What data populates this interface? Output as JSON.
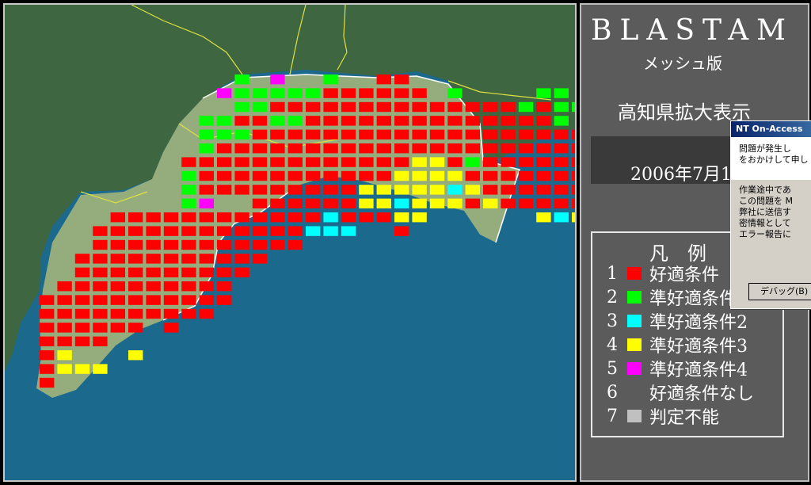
{
  "app": {
    "title": "BLASTAM",
    "subtitle": "メッシュ版",
    "region_label": "高知県拡大表示",
    "date_label": "2006年7月1"
  },
  "legend": {
    "title": "凡　例",
    "items": [
      {
        "num": "1",
        "label": "好適条件",
        "color": "#ff0000"
      },
      {
        "num": "2",
        "label": "準好適条件1",
        "color": "#00ff00"
      },
      {
        "num": "3",
        "label": "準好適条件2",
        "color": "#00ffff"
      },
      {
        "num": "4",
        "label": "準好適条件3",
        "color": "#ffff00"
      },
      {
        "num": "5",
        "label": "準好適条件4",
        "color": "#ff00ff"
      },
      {
        "num": "6",
        "label": "好適条件なし",
        "color": ""
      },
      {
        "num": "7",
        "label": "判定不能",
        "color": "#c0c0c0"
      }
    ]
  },
  "dialog": {
    "title": "NT On-Access",
    "top_lines": [
      "問題が発生し",
      "をおかけして申し"
    ],
    "body_lines": [
      "作業途中であ",
      "",
      "この問題を M",
      "弊社に送信す",
      "密情報として",
      "",
      "エラー報告に"
    ],
    "debug_button": "デバッグ(B)"
  },
  "colors": {
    "sea": "#1b6a8e",
    "land_kochi": "#95ad7d",
    "land_other": "#3d6641",
    "border": "#e0e040",
    "panel": "#5b5b5b"
  },
  "mesh_grid": {
    "comment_codes": "r=1 g=2 c=3 y=4 m=5 blank=none",
    "rows": [
      "...........g.m..g..rr..........",
      "..........mgggggrrrrrr.g....gg..",
      "...........ggrrrrrrrrrrrrrrgrgg..",
      ".........ggrrggrrrrrrrrrrrrrrg..g",
      ".........gggrrrrrrrrrrrrrrrrrrrrg",
      ".........grrrrrrrrrrrrrrrrrrrrr..",
      "........rrrrrrrrrrrrryyrgrrrrrr..",
      "........grrrrrrrrrrryyyyrrrrrrrr.",
      "........grrrrrrrrryyyyycyrrrrrrr.",
      "........gm..rrrrrryycyyyryrrrrr.r",
      "....rrrrrrrrrrrrcrrryy......ycy..",
      "...rrrrrrrrrrrrccc..r............",
      "...rrrrrrrrrrrr..................",
      "..rrrrrrrrrrr....................",
      "..rrrrrrrrrr.....................",
      ".rrrrrrrrrr......................",
      "rrrrrrrrrrr......................",
      "rrrrrrrrrr.......................",
      "rrrrrr.r.........................",
      "rrrr.............................",
      "ry...y...........................",
      "ryyy.............................",
      "r................................"
    ]
  }
}
